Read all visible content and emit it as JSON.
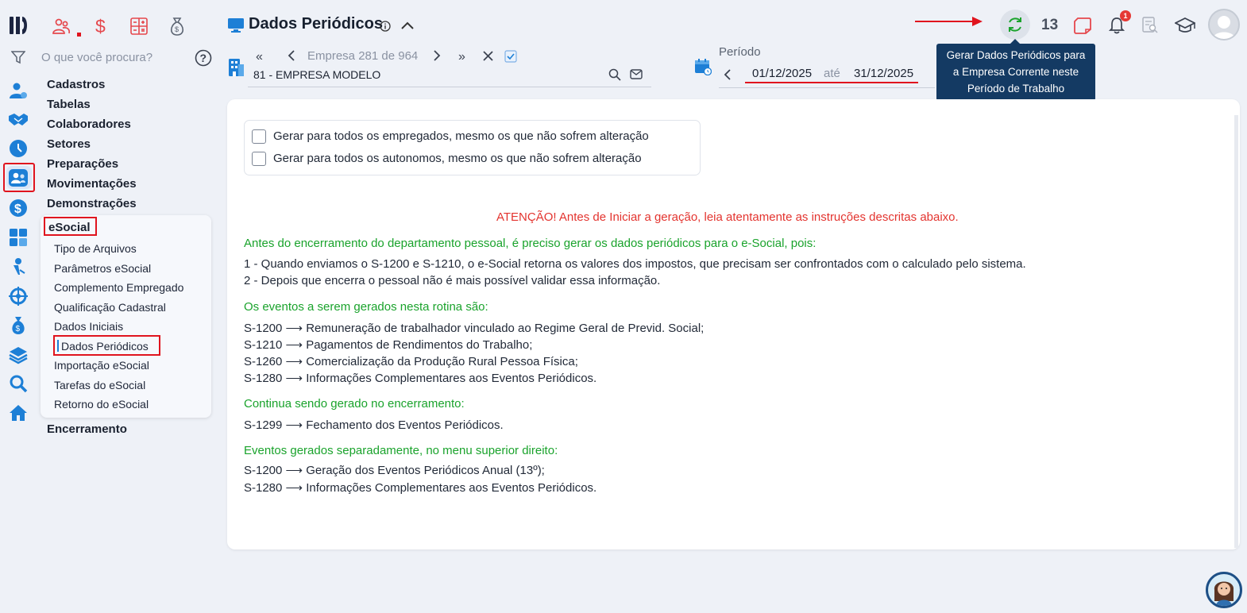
{
  "app": {
    "top_shortcuts": [
      "people-group-icon",
      "dollar-icon",
      "calculator-icon",
      "money-bag-icon"
    ]
  },
  "search": {
    "placeholder": "O que você procura?"
  },
  "menu": {
    "top_items": [
      "Cadastros",
      "Tabelas",
      "Colaboradores",
      "Setores",
      "Preparações",
      "Movimentações",
      "Demonstrações"
    ],
    "esocial_label": "eSocial",
    "esocial_items": [
      "Tipo de Arquivos",
      "Parâmetros eSocial",
      "Complemento Empregado",
      "Qualificação Cadastral",
      "Dados Iniciais",
      "Dados Periódicos",
      "Importação eSocial",
      "Tarefas do eSocial",
      "Retorno do eSocial"
    ],
    "bottom_item": "Encerramento"
  },
  "header": {
    "title": "Dados Periódicos",
    "company_nav": "Empresa 281 de 964",
    "company_value": "81 - EMPRESA MODELO",
    "period_label": "Período",
    "period_start": "01/12/2025",
    "period_sep": "até",
    "period_end": "31/12/2025",
    "counter": "13",
    "notification_count": "1"
  },
  "tooltip": {
    "lines": [
      "Gerar Dados Periódicos para",
      "a Empresa Corrente neste",
      "Período de Trabalho"
    ]
  },
  "options": {
    "opt1": "Gerar para todos os empregados, mesmo os que não sofrem alteração",
    "opt2": "Gerar para todos os autonomos, mesmo os que não sofrem alteração"
  },
  "content": {
    "warning": "ATENÇÃO! Antes de Iniciar a geração, leia atentamente as instruções descritas abaixo.",
    "h1": "Antes do encerramento do departamento pessoal, é preciso gerar os dados periódicos para o e-Social, pois:",
    "p1": "1 - Quando enviamos o S-1200 e S-1210, o e-Social retorna os valores dos impostos, que precisam ser confrontados com o calculado pelo sistema.",
    "p2": "2 - Depois que encerra o pessoal não é mais possível validar essa informação.",
    "h2": "Os eventos a serem gerados nesta rotina são:",
    "e1": "S-1200 ⟶ Remuneração de trabalhador vinculado ao Regime Geral de Previd. Social;",
    "e2": "S-1210  ⟶ Pagamentos de Rendimentos do Trabalho;",
    "e3": "S-1260 ⟶ Comercialização da Produção Rural Pessoa Física;",
    "e4": "S-1280 ⟶ Informações Complementares aos Eventos Periódicos.",
    "h3": "Continua sendo gerado no encerramento:",
    "e5": "S-1299 ⟶ Fechamento dos Eventos Periódicos.",
    "h4": "Eventos gerados separadamente, no menu superior direito:",
    "e6": "S-1200 ⟶ Geração dos Eventos Periódicos Anual (13º);",
    "e7": "S-1280 ⟶ Informações Complementares aos Eventos Periódicos."
  },
  "colors": {
    "accent": "#1d7fd6",
    "warning": "#e3342f",
    "section": "#1aa32c",
    "highlight": "#e0141e",
    "tooltip_bg": "#143a63"
  }
}
